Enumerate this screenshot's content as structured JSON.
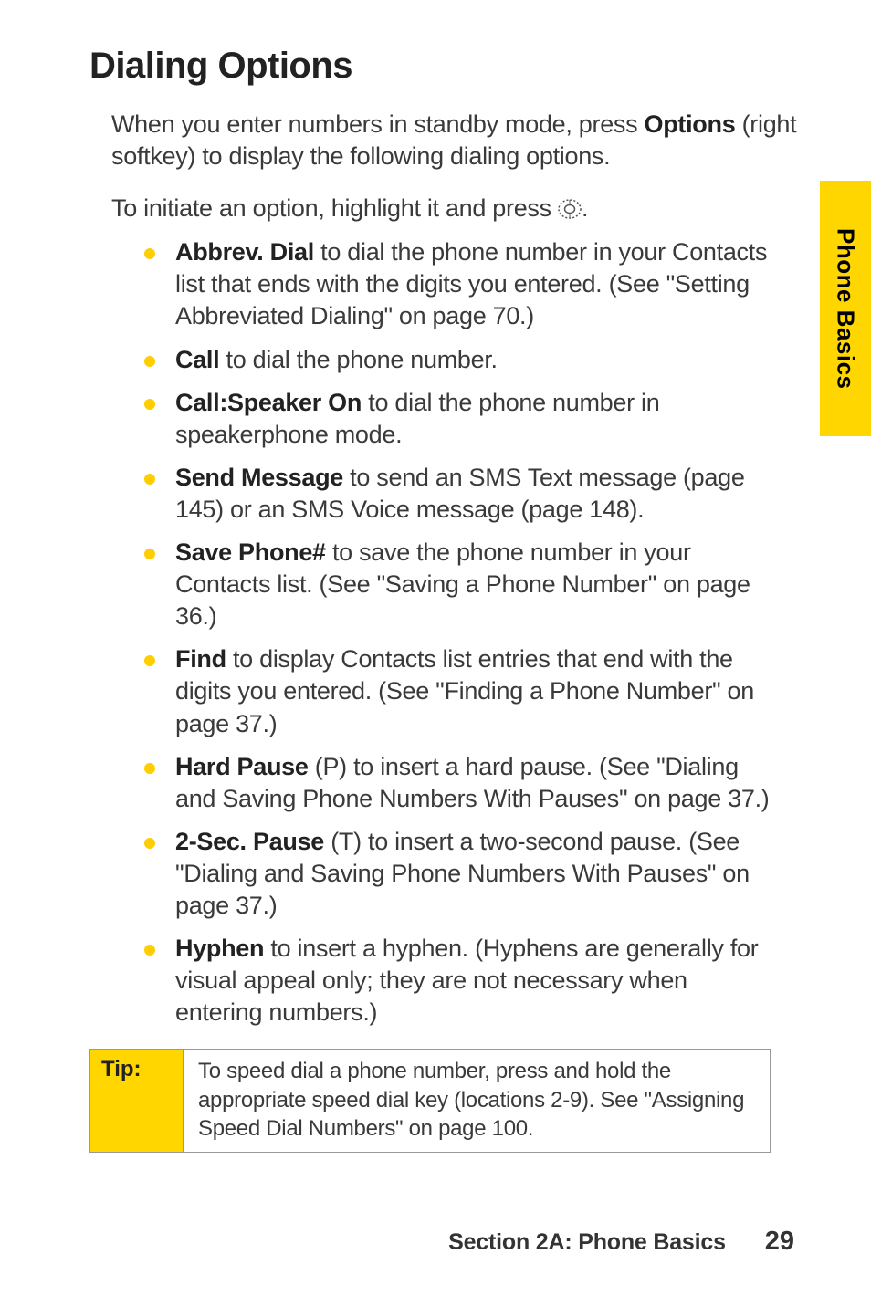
{
  "sideTab": "Phone Basics",
  "heading": "Dialing Options",
  "intro_pre": "When you enter numbers in standby mode, press ",
  "intro_bold": "Options",
  "intro_post": " (right softkey) to display the following dialing options.",
  "initiate_pre": "To initiate an option, highlight it and press ",
  "initiate_post": ".",
  "items": [
    {
      "bold": "Abbrev. Dial",
      "text": " to dial the phone number in your Contacts list that ends with the digits you entered. (See \"Setting Abbreviated Dialing\" on page 70.)"
    },
    {
      "bold": "Call",
      "text": " to dial the phone number."
    },
    {
      "bold": "Call:Speaker On",
      "text": " to dial the phone number in speakerphone mode."
    },
    {
      "bold": "Send Message",
      "text": " to send an SMS Text message (page 145) or an SMS Voice message (page 148)."
    },
    {
      "bold": "Save Phone#",
      "text": " to save the phone number in your Contacts list. (See \"Saving a Phone Number\" on page 36.)"
    },
    {
      "bold": "Find",
      "text": " to display Contacts list entries that end with the digits you entered. (See \"Finding a Phone Number\" on page 37.)"
    },
    {
      "bold": "Hard Pause",
      "text": " (P) to insert a hard pause. (See \"Dialing and Saving Phone Numbers With Pauses\" on page 37.)"
    },
    {
      "bold": "2-Sec. Pause",
      "text": " (T) to insert a two-second pause. (See \"Dialing and Saving Phone Numbers With Pauses\" on page 37.)"
    },
    {
      "bold": "Hyphen",
      "text": " to insert a hyphen. (Hyphens are generally for visual appeal only; they are not necessary when entering numbers.)"
    }
  ],
  "tip": {
    "label": "Tip:",
    "text": "To speed dial a phone number, press and hold the appropriate speed dial key (locations 2-9). See \"Assigning Speed Dial Numbers\" on page 100."
  },
  "footer": {
    "section": "Section 2A: Phone Basics",
    "page": "29"
  }
}
